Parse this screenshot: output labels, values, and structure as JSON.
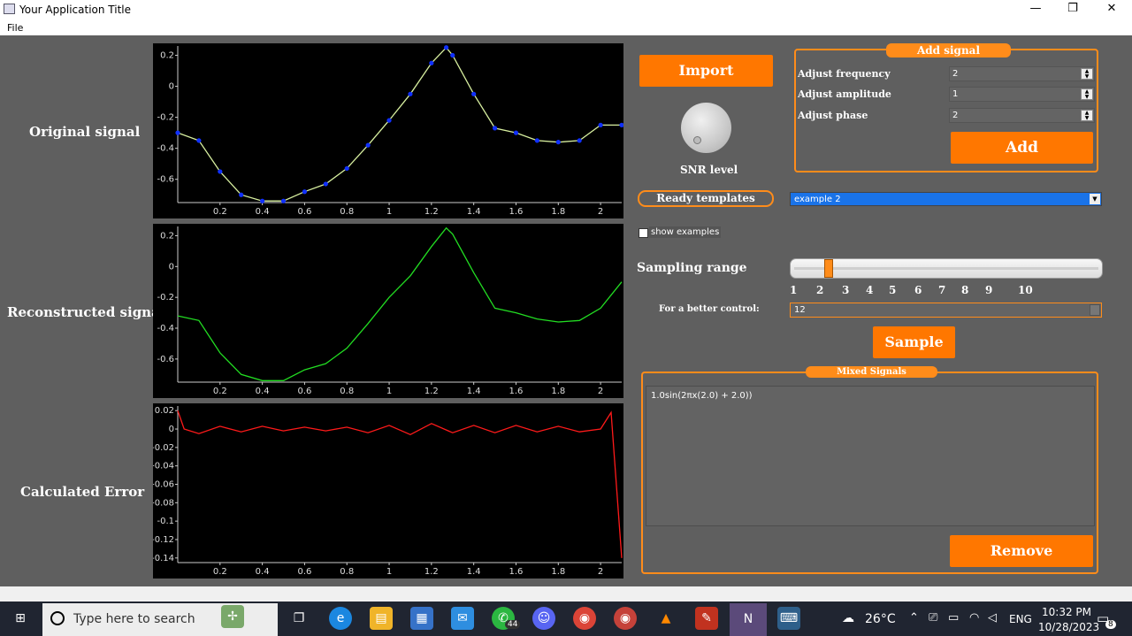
{
  "window": {
    "title": "Your Application Title",
    "minimize_glyph": "—",
    "restore_glyph": "❐",
    "close_glyph": "✕"
  },
  "menu": {
    "file": "File"
  },
  "labels": {
    "original": "Original signal",
    "reconstructed": "Reconstructed signal",
    "error": "Calculated Error",
    "snr": "SNR level",
    "sampling_range": "Sampling range",
    "better_control": "For a better control:"
  },
  "buttons": {
    "import": "Import",
    "add": "Add",
    "sample": "Sample",
    "remove": "Remove",
    "ready_templates": "Ready templates"
  },
  "add_signal": {
    "title": "Add signal",
    "freq_label": "Adjust frequency",
    "freq_value": "2",
    "amp_label": "Adjust amplitude",
    "amp_value": "1",
    "phase_label": "Adjust phase",
    "phase_value": "2"
  },
  "templates": {
    "selected": "example 2"
  },
  "show_examples": {
    "label": "show examples",
    "checked": false
  },
  "sampling": {
    "ticks": [
      "1",
      "2",
      "3",
      "4",
      "5",
      "6",
      "7",
      "8",
      "9",
      "10"
    ],
    "slider_value": 2.3,
    "better_control_value": "12"
  },
  "mixed_signals": {
    "title": "Mixed Signals",
    "items": [
      "1.0sin(2πx(2.0) + 2.0))"
    ]
  },
  "plots": {
    "x_ticks": [
      "0.2",
      "0.4",
      "0.6",
      "0.8",
      "1",
      "1.2",
      "1.4",
      "1.6",
      "1.8",
      "2"
    ],
    "signal_y_ticks": [
      "0.2",
      "0",
      "-0.2",
      "-0.4",
      "-0.6"
    ],
    "error_y_ticks": [
      "0.02",
      "0",
      "-0.02",
      "-0.04",
      "-0.06",
      "-0.08",
      "-0.1",
      "-0.12",
      "-0.14"
    ]
  },
  "taskbar": {
    "search_placeholder": "Type here to search",
    "weather": "26°C",
    "language": "ENG",
    "time": "10:32 PM",
    "date": "10/28/2023",
    "whatsapp_badge": "44",
    "notifications_badge": "8"
  },
  "chart_data": [
    {
      "type": "line",
      "x": [
        0.0,
        0.1,
        0.2,
        0.3,
        0.4,
        0.5,
        0.6,
        0.7,
        0.8,
        0.9,
        1.0,
        1.1,
        1.2,
        1.27,
        1.3,
        1.4,
        1.5,
        1.6,
        1.7,
        1.8,
        1.9,
        2.0,
        2.1
      ],
      "y": [
        -0.3,
        -0.35,
        -0.55,
        -0.7,
        -0.74,
        -0.74,
        -0.68,
        -0.63,
        -0.53,
        -0.38,
        -0.22,
        -0.05,
        0.15,
        0.25,
        0.2,
        -0.05,
        -0.27,
        -0.3,
        -0.35,
        -0.36,
        -0.35,
        -0.25,
        -0.25
      ],
      "xlim": [
        0.0,
        2.1
      ],
      "ylim": [
        -0.75,
        0.26
      ],
      "grid": false
    },
    {
      "type": "line",
      "x": [
        0.0,
        0.1,
        0.2,
        0.3,
        0.4,
        0.5,
        0.6,
        0.7,
        0.8,
        0.9,
        1.0,
        1.1,
        1.2,
        1.27,
        1.3,
        1.4,
        1.5,
        1.6,
        1.7,
        1.8,
        1.9,
        2.0,
        2.1
      ],
      "y": [
        -0.32,
        -0.35,
        -0.56,
        -0.7,
        -0.74,
        -0.74,
        -0.67,
        -0.63,
        -0.53,
        -0.37,
        -0.2,
        -0.06,
        0.13,
        0.25,
        0.21,
        -0.04,
        -0.27,
        -0.3,
        -0.34,
        -0.36,
        -0.35,
        -0.27,
        -0.1
      ],
      "xlim": [
        0.0,
        2.1
      ],
      "ylim": [
        -0.75,
        0.26
      ],
      "grid": false
    },
    {
      "type": "line",
      "x": [
        0.0,
        0.03,
        0.1,
        0.2,
        0.3,
        0.4,
        0.5,
        0.6,
        0.7,
        0.8,
        0.9,
        1.0,
        1.1,
        1.2,
        1.3,
        1.4,
        1.5,
        1.6,
        1.7,
        1.8,
        1.9,
        2.0,
        2.05,
        2.1
      ],
      "y": [
        0.02,
        0.0,
        -0.005,
        0.003,
        -0.003,
        0.003,
        -0.002,
        0.002,
        -0.002,
        0.002,
        -0.004,
        0.004,
        -0.006,
        0.006,
        -0.004,
        0.004,
        -0.004,
        0.004,
        -0.003,
        0.003,
        -0.003,
        0.0,
        0.018,
        -0.14
      ],
      "xlim": [
        0.0,
        2.1
      ],
      "ylim": [
        -0.145,
        0.025
      ],
      "grid": false
    }
  ]
}
